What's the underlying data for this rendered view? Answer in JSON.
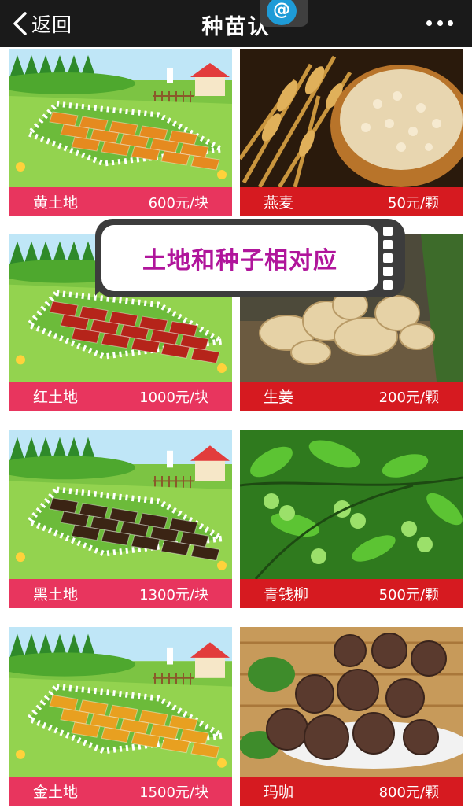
{
  "nav": {
    "back_label": "返回",
    "title": "种苗认",
    "badge_symbol": "@"
  },
  "callout": "土地和种子相对应",
  "lands": [
    {
      "name": "黄土地",
      "price": "600元/块",
      "soil_color": "#e58a1f"
    },
    {
      "name": "红土地",
      "price": "1000元/块",
      "soil_color": "#b5241a"
    },
    {
      "name": "黑土地",
      "price": "1300元/块",
      "soil_color": "#3b2414"
    },
    {
      "name": "金土地",
      "price": "1500元/块",
      "soil_color": "#e8a020"
    }
  ],
  "seeds": [
    {
      "name": "燕麦",
      "price": "50元/颗"
    },
    {
      "name": "生姜",
      "price": "200元/颗"
    },
    {
      "name": "青钱柳",
      "price": "500元/颗"
    },
    {
      "name": "玛咖",
      "price": "800元/颗"
    }
  ],
  "colors": {
    "land_label": "#e8355e",
    "seed_label": "#d61a20",
    "callout_text": "#b0159b",
    "topbar": "#1a1a1a"
  }
}
